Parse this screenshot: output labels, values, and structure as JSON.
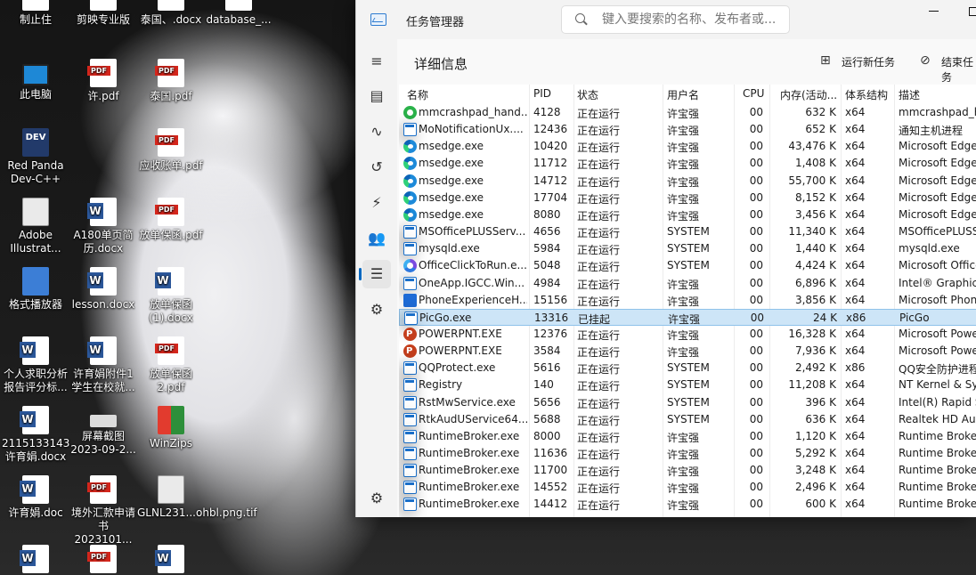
{
  "desktop": {
    "icons": [
      {
        "label": "制止住",
        "type": "blank"
      },
      {
        "label": "剪映专业版",
        "type": "blank"
      },
      {
        "label": "泰国、.docx",
        "type": "blank"
      },
      {
        "label": "database_...",
        "type": "blank"
      },
      {
        "label": "此电脑",
        "type": "pc"
      },
      {
        "label": "许.pdf",
        "type": "pdf"
      },
      {
        "label": "泰国.pdf",
        "type": "pdf"
      },
      {
        "label": "Red Panda Dev-C++",
        "type": "dev"
      },
      {
        "label": "应收账单.pdf",
        "type": "pdf"
      },
      {
        "label": "Adobe Illustrat...",
        "type": "img"
      },
      {
        "label": "A180单页简历.docx",
        "type": "word"
      },
      {
        "label": "放单保函.pdf",
        "type": "pdf"
      },
      {
        "label": "格式播放器",
        "type": "media"
      },
      {
        "label": "lesson.docx",
        "type": "word"
      },
      {
        "label": "放单保函(1).docx",
        "type": "word"
      },
      {
        "label": "个人求职分析报告评分标...",
        "type": "word"
      },
      {
        "label": "许育娟附件1学生在校就...",
        "type": "word"
      },
      {
        "label": "放单保函2.pdf",
        "type": "pdf"
      },
      {
        "label": "2115133143许育娟.docx",
        "type": "word"
      },
      {
        "label": "屏幕截图 2023-09-2...",
        "type": "shot"
      },
      {
        "label": "WinZips",
        "type": "wz"
      },
      {
        "label": "许育娟.doc",
        "type": "word"
      },
      {
        "label": "境外汇款申请书2023101...",
        "type": "pdf"
      },
      {
        "label": "GLNL231...ohbl.png.tif",
        "type": "img"
      },
      {
        "label": "",
        "type": "word"
      },
      {
        "label": "",
        "type": "pdf"
      },
      {
        "label": "",
        "type": "word"
      }
    ]
  },
  "window": {
    "title": "任务管理器",
    "search_placeholder": "键入要搜索的名称、发布者或...",
    "page_title": "详细信息",
    "run_new_task": "运行新任务",
    "end_task": "结束任务"
  },
  "nav": [
    {
      "name": "menu-icon",
      "glyph": "≡"
    },
    {
      "name": "processes-icon",
      "glyph": "▤"
    },
    {
      "name": "performance-icon",
      "glyph": "∿"
    },
    {
      "name": "app-history-icon",
      "glyph": "↺"
    },
    {
      "name": "startup-icon",
      "glyph": "⚡"
    },
    {
      "name": "users-icon",
      "glyph": "👥"
    },
    {
      "name": "details-icon",
      "glyph": "☰"
    },
    {
      "name": "services-icon",
      "glyph": "⚙"
    },
    {
      "name": "settings-icon",
      "glyph": "⚙"
    }
  ],
  "table": {
    "headers": [
      "名称",
      "PID",
      "状态",
      "用户名",
      "CPU",
      "内存(活动...",
      "体系结构",
      "描述"
    ],
    "rows": [
      {
        "icon": "green",
        "name": "mmcrashpad_hand...",
        "pid": "4128",
        "status": "正在运行",
        "user": "许宝强",
        "cpu": "00",
        "mem": "632 K",
        "arch": "x64",
        "desc": "mmcrashpad_h"
      },
      {
        "icon": "win",
        "name": "MoNotificationUx....",
        "pid": "12436",
        "status": "正在运行",
        "user": "许宝强",
        "cpu": "00",
        "mem": "652 K",
        "arch": "x64",
        "desc": "通知主机进程"
      },
      {
        "icon": "edge",
        "name": "msedge.exe",
        "pid": "10420",
        "status": "正在运行",
        "user": "许宝强",
        "cpu": "00",
        "mem": "43,476 K",
        "arch": "x64",
        "desc": "Microsoft Edge"
      },
      {
        "icon": "edge",
        "name": "msedge.exe",
        "pid": "11712",
        "status": "正在运行",
        "user": "许宝强",
        "cpu": "00",
        "mem": "1,408 K",
        "arch": "x64",
        "desc": "Microsoft Edge"
      },
      {
        "icon": "edge",
        "name": "msedge.exe",
        "pid": "14712",
        "status": "正在运行",
        "user": "许宝强",
        "cpu": "00",
        "mem": "55,700 K",
        "arch": "x64",
        "desc": "Microsoft Edge"
      },
      {
        "icon": "edge",
        "name": "msedge.exe",
        "pid": "17704",
        "status": "正在运行",
        "user": "许宝强",
        "cpu": "00",
        "mem": "8,152 K",
        "arch": "x64",
        "desc": "Microsoft Edge"
      },
      {
        "icon": "edge",
        "name": "msedge.exe",
        "pid": "8080",
        "status": "正在运行",
        "user": "许宝强",
        "cpu": "00",
        "mem": "3,456 K",
        "arch": "x64",
        "desc": "Microsoft Edge"
      },
      {
        "icon": "win",
        "name": "MSOfficePLUSServ...",
        "pid": "4656",
        "status": "正在运行",
        "user": "SYSTEM",
        "cpu": "00",
        "mem": "11,340 K",
        "arch": "x64",
        "desc": "MSOfficePLUSS"
      },
      {
        "icon": "win",
        "name": "mysqld.exe",
        "pid": "5984",
        "status": "正在运行",
        "user": "SYSTEM",
        "cpu": "00",
        "mem": "1,440 K",
        "arch": "x64",
        "desc": "mysqld.exe"
      },
      {
        "icon": "office",
        "name": "OfficeClickToRun.e...",
        "pid": "5048",
        "status": "正在运行",
        "user": "SYSTEM",
        "cpu": "00",
        "mem": "4,424 K",
        "arch": "x64",
        "desc": "Microsoft Office"
      },
      {
        "icon": "win",
        "name": "OneApp.IGCC.Win...",
        "pid": "4984",
        "status": "正在运行",
        "user": "许宝强",
        "cpu": "00",
        "mem": "6,896 K",
        "arch": "x64",
        "desc": "Intel® Graphics"
      },
      {
        "icon": "phone",
        "name": "PhoneExperienceH...",
        "pid": "15156",
        "status": "正在运行",
        "user": "许宝强",
        "cpu": "00",
        "mem": "3,856 K",
        "arch": "x64",
        "desc": "Microsoft Phon"
      },
      {
        "icon": "win",
        "name": "PicGo.exe",
        "pid": "13316",
        "status": "已挂起",
        "user": "许宝强",
        "cpu": "00",
        "mem": "24 K",
        "arch": "x86",
        "desc": "PicGo",
        "selected": true
      },
      {
        "icon": "ppt",
        "name": "POWERPNT.EXE",
        "pid": "12376",
        "status": "正在运行",
        "user": "许宝强",
        "cpu": "00",
        "mem": "16,328 K",
        "arch": "x64",
        "desc": "Microsoft Powe"
      },
      {
        "icon": "ppt",
        "name": "POWERPNT.EXE",
        "pid": "3584",
        "status": "正在运行",
        "user": "许宝强",
        "cpu": "00",
        "mem": "7,936 K",
        "arch": "x64",
        "desc": "Microsoft Powe"
      },
      {
        "icon": "win",
        "name": "QQProtect.exe",
        "pid": "5616",
        "status": "正在运行",
        "user": "SYSTEM",
        "cpu": "00",
        "mem": "2,492 K",
        "arch": "x86",
        "desc": "QQ安全防护进程"
      },
      {
        "icon": "win",
        "name": "Registry",
        "pid": "140",
        "status": "正在运行",
        "user": "SYSTEM",
        "cpu": "00",
        "mem": "11,208 K",
        "arch": "x64",
        "desc": "NT Kernel & Sy"
      },
      {
        "icon": "win",
        "name": "RstMwService.exe",
        "pid": "5656",
        "status": "正在运行",
        "user": "SYSTEM",
        "cpu": "00",
        "mem": "396 K",
        "arch": "x64",
        "desc": "Intel(R) Rapid S"
      },
      {
        "icon": "win",
        "name": "RtkAudUService64...",
        "pid": "5688",
        "status": "正在运行",
        "user": "SYSTEM",
        "cpu": "00",
        "mem": "636 K",
        "arch": "x64",
        "desc": "Realtek HD Aud"
      },
      {
        "icon": "win",
        "name": "RuntimeBroker.exe",
        "pid": "8000",
        "status": "正在运行",
        "user": "许宝强",
        "cpu": "00",
        "mem": "1,120 K",
        "arch": "x64",
        "desc": "Runtime Broker"
      },
      {
        "icon": "win",
        "name": "RuntimeBroker.exe",
        "pid": "11636",
        "status": "正在运行",
        "user": "许宝强",
        "cpu": "00",
        "mem": "5,292 K",
        "arch": "x64",
        "desc": "Runtime Broker"
      },
      {
        "icon": "win",
        "name": "RuntimeBroker.exe",
        "pid": "11700",
        "status": "正在运行",
        "user": "许宝强",
        "cpu": "00",
        "mem": "3,248 K",
        "arch": "x64",
        "desc": "Runtime Broker"
      },
      {
        "icon": "win",
        "name": "RuntimeBroker.exe",
        "pid": "14552",
        "status": "正在运行",
        "user": "许宝强",
        "cpu": "00",
        "mem": "2,496 K",
        "arch": "x64",
        "desc": "Runtime Broker"
      },
      {
        "icon": "win",
        "name": "RuntimeBroker.exe",
        "pid": "14412",
        "status": "正在运行",
        "user": "许宝强",
        "cpu": "00",
        "mem": "600 K",
        "arch": "x64",
        "desc": "Runtime Broker"
      }
    ]
  }
}
